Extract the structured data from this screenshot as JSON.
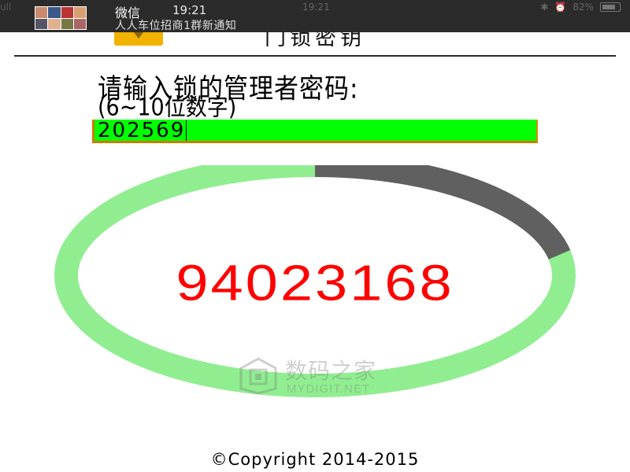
{
  "notification": {
    "app_name": "微信",
    "time": "19:21",
    "message": "人人车位招商1群新通知",
    "status_left_faded": "ull",
    "status_time_faded": "19:21",
    "battery_text": "82%"
  },
  "header": {
    "title": "门锁密钥"
  },
  "prompt": {
    "line1": "请输入锁的管理者密码:",
    "line2": "(6~10位数字)"
  },
  "password_input": {
    "value": "202569"
  },
  "ring": {
    "progress_fraction": 0.22,
    "track_color": "#90ee90",
    "progress_color": "#606060"
  },
  "result": {
    "code": "94023168",
    "color": "#ff0000"
  },
  "watermark": {
    "cn": "数码之家",
    "en": "MYDIGIT.NET"
  },
  "footer": {
    "copyright": "©Copyright 2014-2015"
  },
  "colors": {
    "input_bg": "#00ff00",
    "input_border": "#ce7a00",
    "back_button": "#f2b200",
    "notification_bg": "#2b2b2b"
  },
  "icons": [
    "back-arrow-icon",
    "avatar-group-icon",
    "battery-icon",
    "mydigit-logo-icon"
  ]
}
